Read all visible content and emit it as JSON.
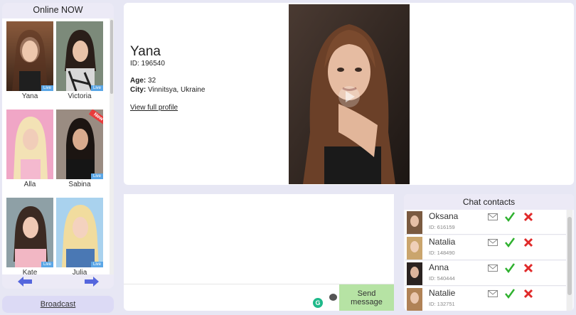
{
  "online": {
    "title": "Online NOW",
    "cards": [
      {
        "name": "Yana",
        "live": "Live",
        "new": false
      },
      {
        "name": "Victoria",
        "live": "Live",
        "new": false
      },
      {
        "name": "Alla",
        "live": "",
        "new": false
      },
      {
        "name": "Sabina",
        "live": "Live",
        "new": true,
        "new_label": "New"
      },
      {
        "name": "Kate",
        "live": "Live",
        "new": false
      },
      {
        "name": "Julia",
        "live": "Live",
        "new": false
      }
    ],
    "prev_icon": "arrow-left-icon",
    "next_icon": "arrow-right-icon"
  },
  "broadcast": {
    "label": "Broadcast"
  },
  "profile": {
    "name": "Yana",
    "id_text": "ID: 196540",
    "age_label": "Age:",
    "age": "32",
    "city_label": "City:",
    "city": "Vinnitsya, Ukraine",
    "view_link": "View full profile"
  },
  "message": {
    "placeholder": "",
    "send_label": "Send message",
    "grammarly_icon": "G"
  },
  "contacts": {
    "title": "Chat contacts",
    "items": [
      {
        "name": "Oksana",
        "id": "ID: 616159"
      },
      {
        "name": "Natalia",
        "id": "ID: 148490"
      },
      {
        "name": "Anna",
        "id": "ID: 540444"
      },
      {
        "name": "Natalie",
        "id": "ID: 132751"
      }
    ]
  },
  "colors": {
    "accent": "#5aa6e6",
    "send_bg": "#b6e3a4",
    "accept": "#2fb12f",
    "decline": "#e02a2a",
    "page_bg": "#e7e7f4"
  }
}
